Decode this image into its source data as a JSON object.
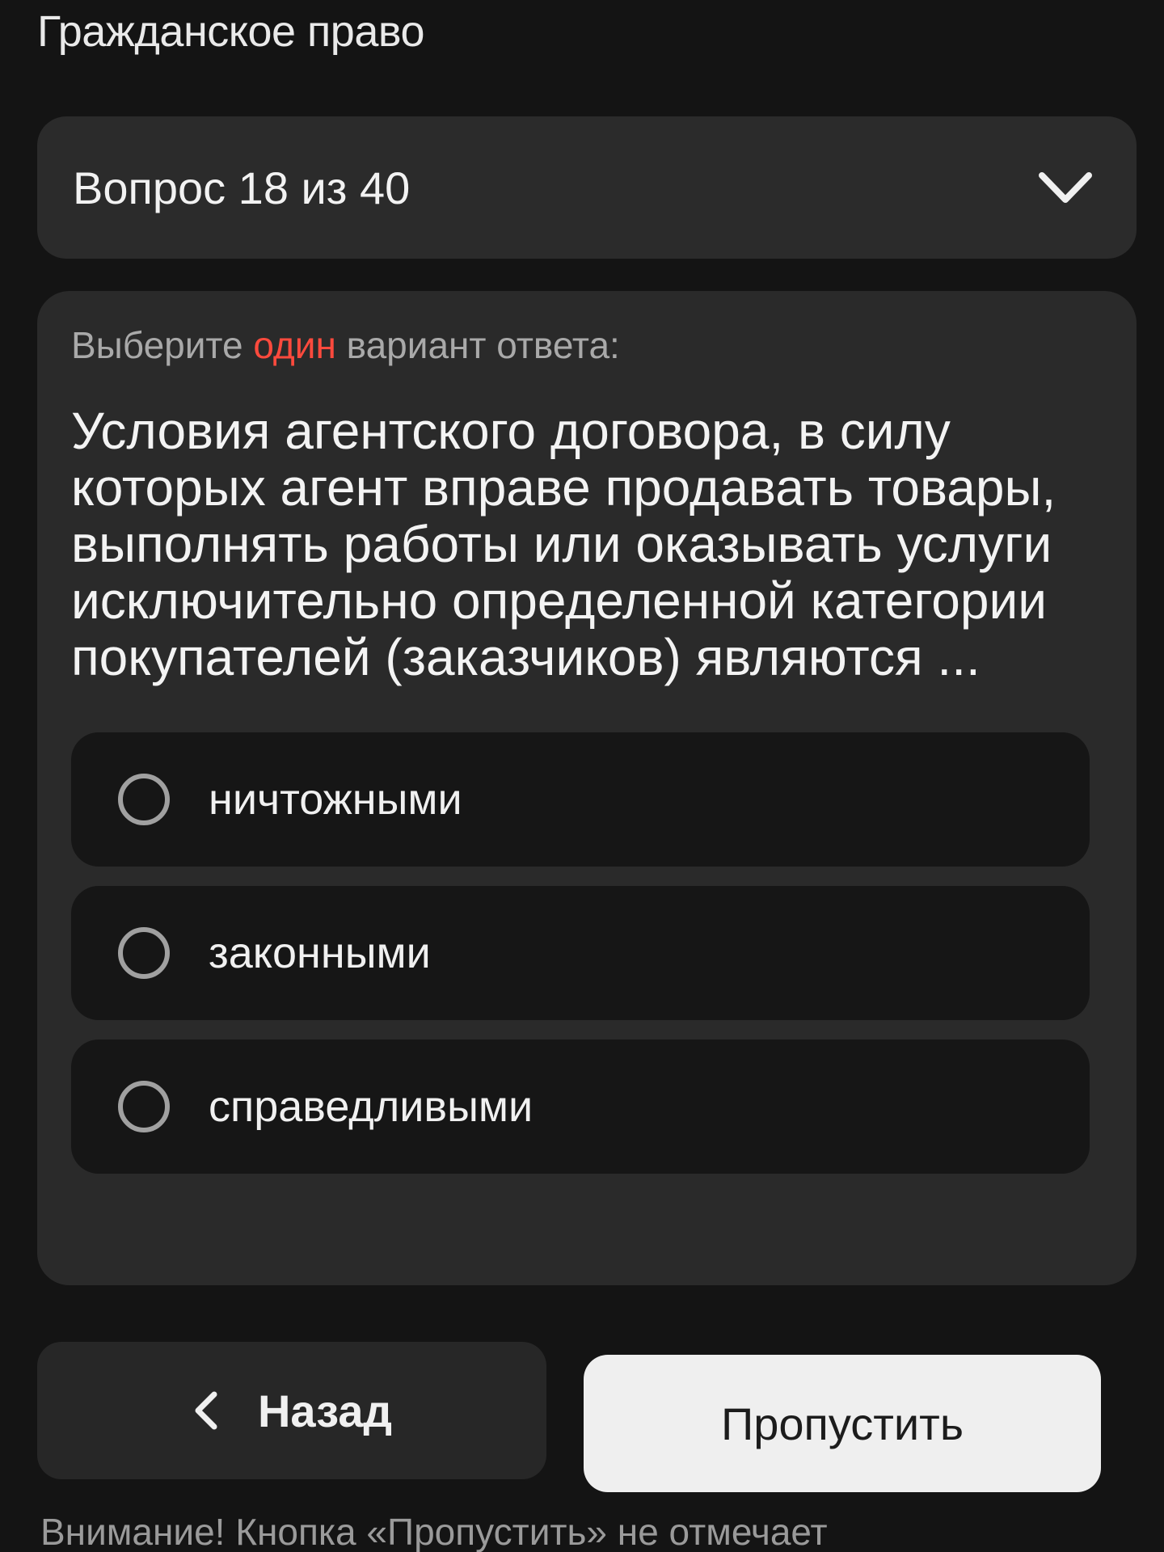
{
  "header": {
    "title": "Гражданское право"
  },
  "question_selector": {
    "label": "Вопрос 18 из 40",
    "icon": "chevron-down-icon"
  },
  "question": {
    "instruction_prefix": "Выберите ",
    "instruction_accent": "один",
    "instruction_suffix": " вариант ответа:",
    "accent_color": "#ff4a3d",
    "text": "Условия агентского договора, в силу которых агент вправе продавать товары, выполнять работы или оказывать услуги исключительно определенной категории покупателей (заказчиков) являются ...",
    "options": [
      {
        "label": "ничтожными",
        "selected": false
      },
      {
        "label": "законными",
        "selected": false
      },
      {
        "label": "справедливыми",
        "selected": false
      }
    ]
  },
  "footer": {
    "back_label": "Назад",
    "back_icon": "chevron-left-icon",
    "skip_label": "Пропустить",
    "warning_text": "Внимание! Кнопка «Пропустить» не отмечает"
  }
}
